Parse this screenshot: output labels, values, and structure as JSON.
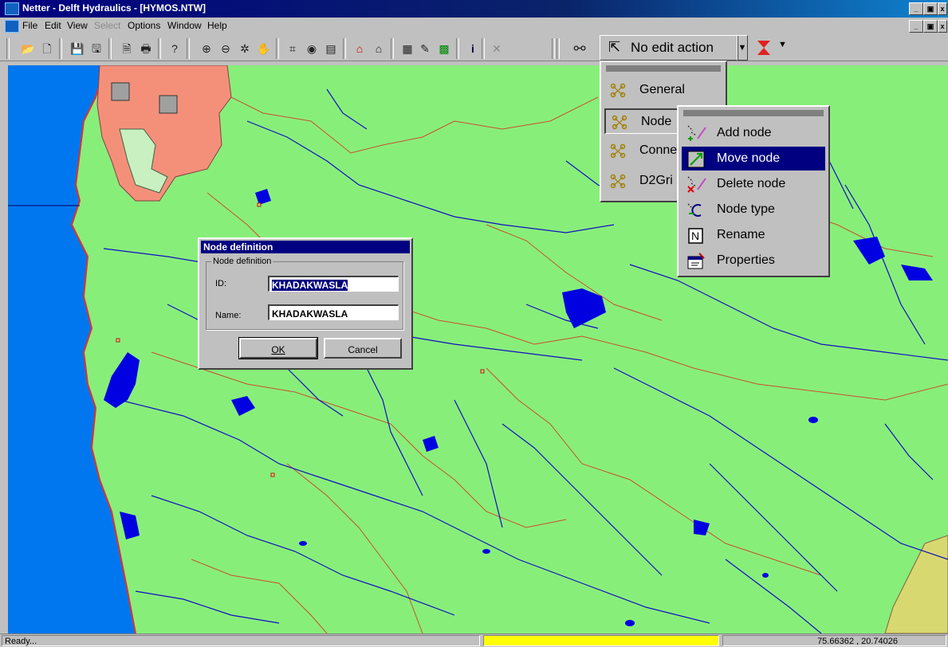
{
  "window": {
    "title": "Netter - Delft Hydraulics - [HYMOS.NTW]",
    "minimize": "_",
    "maximize": "▣",
    "close": "x"
  },
  "menu": {
    "file": "File",
    "edit": "Edit",
    "view": "View",
    "select": "Select",
    "options": "Options",
    "window": "Window",
    "help": "Help"
  },
  "toolbar": {
    "edit_action_label": "No edit action",
    "icons": [
      "open-folder-icon",
      "new-file-icon",
      "save-icon",
      "save-as-icon",
      "new-page-icon",
      "print-icon",
      "help-icon",
      "zoom-in-icon",
      "zoom-out-icon",
      "zoom-extent-icon",
      "pan-hand-icon",
      "layer-icon",
      "network-icon",
      "map-icon",
      "node-tool-icon",
      "link-tool-icon",
      "draw-icon",
      "pencil-icon",
      "grid-icon",
      "info-icon",
      "pin-icon"
    ]
  },
  "edit_menu": {
    "items": [
      {
        "label": "General"
      },
      {
        "label": "Node"
      },
      {
        "label": "Conne"
      },
      {
        "label": "D2Gri"
      }
    ]
  },
  "node_submenu": {
    "items": [
      {
        "label": "Add node",
        "icon": "add-node-icon"
      },
      {
        "label": "Move node",
        "icon": "move-node-icon",
        "selected": true
      },
      {
        "label": "Delete node",
        "icon": "delete-node-icon"
      },
      {
        "label": "Node type",
        "icon": "node-type-icon"
      },
      {
        "label": "Rename",
        "icon": "rename-icon"
      },
      {
        "label": "Properties",
        "icon": "properties-icon"
      }
    ]
  },
  "dialog": {
    "title": "Node definition",
    "group_label": "Node definition",
    "id_label": "ID:",
    "id_value": "KHADAKWASLA",
    "name_label": "Name:",
    "name_value": "KHADAKWASLA",
    "ok_label": "OK",
    "cancel_label": "Cancel"
  },
  "statusbar": {
    "status_text": "Ready...",
    "coordinates": "75.66362 , 20.74026"
  },
  "colors": {
    "land": "#88ee7a",
    "sea": "#0077ee",
    "river": "#1010c0",
    "road": "#c04040",
    "region_salmon": "#f4907a",
    "region_yellow": "#d8d870",
    "highlight": "#000080",
    "status_indicator": "#ffff00"
  }
}
